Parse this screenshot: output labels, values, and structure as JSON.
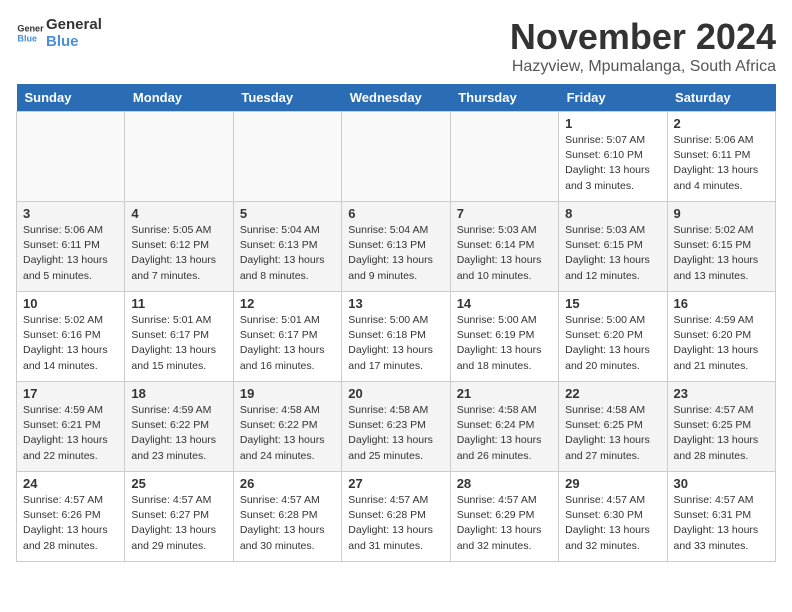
{
  "header": {
    "logo_line1": "General",
    "logo_line2": "Blue",
    "title": "November 2024",
    "subtitle": "Hazyview, Mpumalanga, South Africa"
  },
  "days_of_week": [
    "Sunday",
    "Monday",
    "Tuesday",
    "Wednesday",
    "Thursday",
    "Friday",
    "Saturday"
  ],
  "weeks": [
    [
      {
        "day": "",
        "info": ""
      },
      {
        "day": "",
        "info": ""
      },
      {
        "day": "",
        "info": ""
      },
      {
        "day": "",
        "info": ""
      },
      {
        "day": "",
        "info": ""
      },
      {
        "day": "1",
        "info": "Sunrise: 5:07 AM\nSunset: 6:10 PM\nDaylight: 13 hours and 3 minutes."
      },
      {
        "day": "2",
        "info": "Sunrise: 5:06 AM\nSunset: 6:11 PM\nDaylight: 13 hours and 4 minutes."
      }
    ],
    [
      {
        "day": "3",
        "info": "Sunrise: 5:06 AM\nSunset: 6:11 PM\nDaylight: 13 hours and 5 minutes."
      },
      {
        "day": "4",
        "info": "Sunrise: 5:05 AM\nSunset: 6:12 PM\nDaylight: 13 hours and 7 minutes."
      },
      {
        "day": "5",
        "info": "Sunrise: 5:04 AM\nSunset: 6:13 PM\nDaylight: 13 hours and 8 minutes."
      },
      {
        "day": "6",
        "info": "Sunrise: 5:04 AM\nSunset: 6:13 PM\nDaylight: 13 hours and 9 minutes."
      },
      {
        "day": "7",
        "info": "Sunrise: 5:03 AM\nSunset: 6:14 PM\nDaylight: 13 hours and 10 minutes."
      },
      {
        "day": "8",
        "info": "Sunrise: 5:03 AM\nSunset: 6:15 PM\nDaylight: 13 hours and 12 minutes."
      },
      {
        "day": "9",
        "info": "Sunrise: 5:02 AM\nSunset: 6:15 PM\nDaylight: 13 hours and 13 minutes."
      }
    ],
    [
      {
        "day": "10",
        "info": "Sunrise: 5:02 AM\nSunset: 6:16 PM\nDaylight: 13 hours and 14 minutes."
      },
      {
        "day": "11",
        "info": "Sunrise: 5:01 AM\nSunset: 6:17 PM\nDaylight: 13 hours and 15 minutes."
      },
      {
        "day": "12",
        "info": "Sunrise: 5:01 AM\nSunset: 6:17 PM\nDaylight: 13 hours and 16 minutes."
      },
      {
        "day": "13",
        "info": "Sunrise: 5:00 AM\nSunset: 6:18 PM\nDaylight: 13 hours and 17 minutes."
      },
      {
        "day": "14",
        "info": "Sunrise: 5:00 AM\nSunset: 6:19 PM\nDaylight: 13 hours and 18 minutes."
      },
      {
        "day": "15",
        "info": "Sunrise: 5:00 AM\nSunset: 6:20 PM\nDaylight: 13 hours and 20 minutes."
      },
      {
        "day": "16",
        "info": "Sunrise: 4:59 AM\nSunset: 6:20 PM\nDaylight: 13 hours and 21 minutes."
      }
    ],
    [
      {
        "day": "17",
        "info": "Sunrise: 4:59 AM\nSunset: 6:21 PM\nDaylight: 13 hours and 22 minutes."
      },
      {
        "day": "18",
        "info": "Sunrise: 4:59 AM\nSunset: 6:22 PM\nDaylight: 13 hours and 23 minutes."
      },
      {
        "day": "19",
        "info": "Sunrise: 4:58 AM\nSunset: 6:22 PM\nDaylight: 13 hours and 24 minutes."
      },
      {
        "day": "20",
        "info": "Sunrise: 4:58 AM\nSunset: 6:23 PM\nDaylight: 13 hours and 25 minutes."
      },
      {
        "day": "21",
        "info": "Sunrise: 4:58 AM\nSunset: 6:24 PM\nDaylight: 13 hours and 26 minutes."
      },
      {
        "day": "22",
        "info": "Sunrise: 4:58 AM\nSunset: 6:25 PM\nDaylight: 13 hours and 27 minutes."
      },
      {
        "day": "23",
        "info": "Sunrise: 4:57 AM\nSunset: 6:25 PM\nDaylight: 13 hours and 28 minutes."
      }
    ],
    [
      {
        "day": "24",
        "info": "Sunrise: 4:57 AM\nSunset: 6:26 PM\nDaylight: 13 hours and 28 minutes."
      },
      {
        "day": "25",
        "info": "Sunrise: 4:57 AM\nSunset: 6:27 PM\nDaylight: 13 hours and 29 minutes."
      },
      {
        "day": "26",
        "info": "Sunrise: 4:57 AM\nSunset: 6:28 PM\nDaylight: 13 hours and 30 minutes."
      },
      {
        "day": "27",
        "info": "Sunrise: 4:57 AM\nSunset: 6:28 PM\nDaylight: 13 hours and 31 minutes."
      },
      {
        "day": "28",
        "info": "Sunrise: 4:57 AM\nSunset: 6:29 PM\nDaylight: 13 hours and 32 minutes."
      },
      {
        "day": "29",
        "info": "Sunrise: 4:57 AM\nSunset: 6:30 PM\nDaylight: 13 hours and 32 minutes."
      },
      {
        "day": "30",
        "info": "Sunrise: 4:57 AM\nSunset: 6:31 PM\nDaylight: 13 hours and 33 minutes."
      }
    ]
  ]
}
